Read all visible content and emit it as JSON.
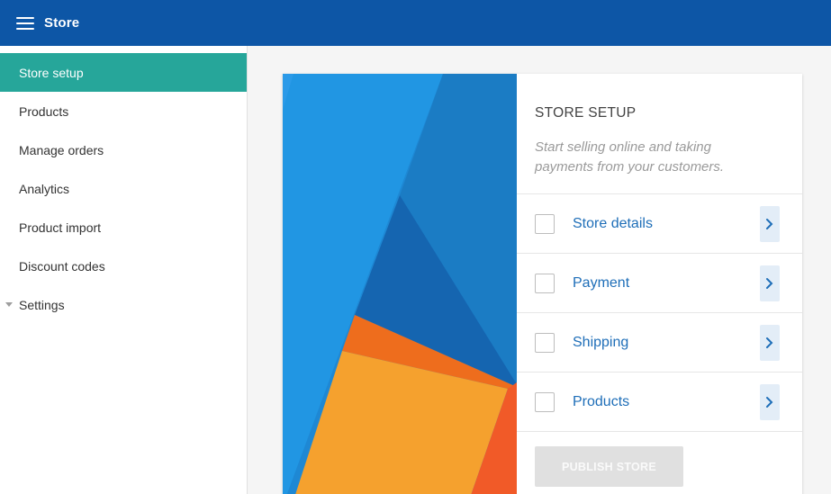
{
  "header": {
    "title": "Store"
  },
  "sidebar": {
    "items": [
      {
        "label": "Store setup"
      },
      {
        "label": "Products"
      },
      {
        "label": "Manage orders"
      },
      {
        "label": "Analytics"
      },
      {
        "label": "Product import"
      },
      {
        "label": "Discount codes"
      },
      {
        "label": "Settings"
      }
    ]
  },
  "setup": {
    "title": "STORE SETUP",
    "subtitle": "Start selling online and taking payments from your customers.",
    "steps": [
      {
        "label": "Store details"
      },
      {
        "label": "Payment"
      },
      {
        "label": "Shipping"
      },
      {
        "label": "Products"
      }
    ],
    "publish_label": "PUBLISH STORE"
  },
  "colors": {
    "header": "#0d56a6",
    "active_nav": "#26a69a",
    "link": "#1e6eb8"
  }
}
